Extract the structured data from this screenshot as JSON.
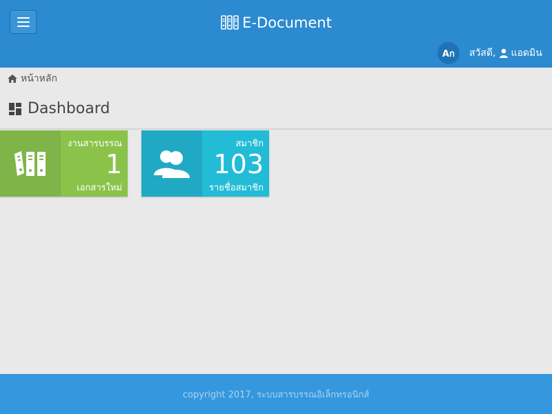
{
  "app": {
    "title": "E-Document"
  },
  "header": {
    "menu_icon": "hamburger-icon",
    "lang_label": "Aก",
    "greeting": "สวัสดี,",
    "username": "แอดมิน"
  },
  "breadcrumb": {
    "home": "หน้าหลัก"
  },
  "page": {
    "title": "Dashboard"
  },
  "tiles": [
    {
      "top_label": "งานสารบรรณ",
      "value": "1",
      "bottom_label": "เอกสารใหม่",
      "icon": "binders-icon",
      "color": "#8bc34a"
    },
    {
      "top_label": "สมาชิก",
      "value": "103",
      "bottom_label": "รายชื่อสมาชิก",
      "icon": "users-icon",
      "color": "#22bcd6"
    }
  ],
  "footer": {
    "text": "copyright 2017, ระบบสารบรรณอิเล็กทรอนิกส์"
  },
  "colors": {
    "primary": "#2b8ad0",
    "footer": "#3597dd",
    "green": "#8bc34a",
    "cyan": "#22bcd6"
  }
}
